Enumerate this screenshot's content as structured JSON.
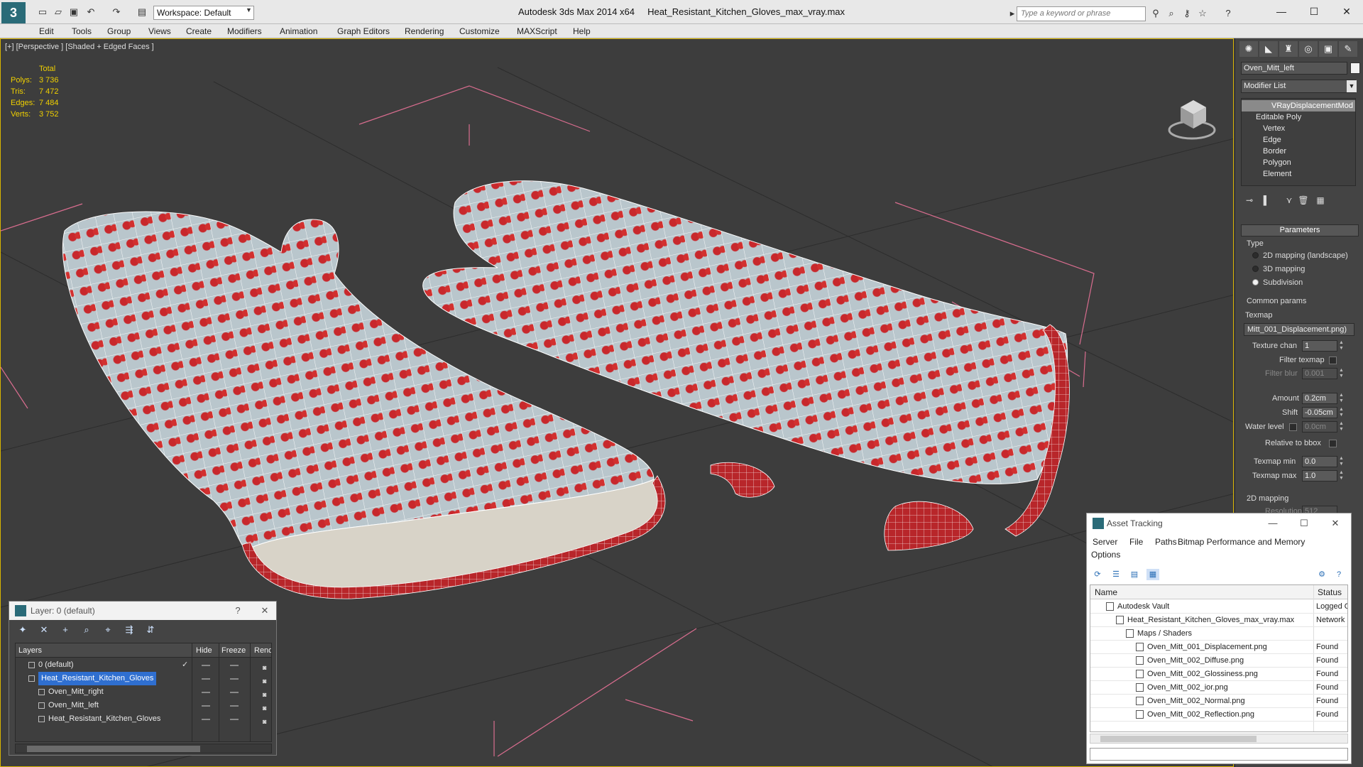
{
  "titlebar": {
    "app_title": "Autodesk 3ds Max  2014 x64",
    "file_name": "Heat_Resistant_Kitchen_Gloves_max_vray.max",
    "workspace": "Workspace: Default",
    "search_placeholder": "Type a keyword or phrase"
  },
  "menu": [
    "Edit",
    "Tools",
    "Group",
    "Views",
    "Create",
    "Modifiers",
    "Animation",
    "Graph Editors",
    "Rendering",
    "Customize",
    "MAXScript",
    "Help"
  ],
  "viewport": {
    "label": "[+] [Perspective ] [Shaded + Edged Faces ]",
    "stats": {
      "header": "Total",
      "rows": [
        {
          "k": "Polys:",
          "v": "3 736"
        },
        {
          "k": "Tris:",
          "v": "7 472"
        },
        {
          "k": "Edges:",
          "v": "7 484"
        },
        {
          "k": "Verts:",
          "v": "3 752"
        }
      ]
    }
  },
  "command_panel": {
    "object_name": "Oven_Mitt_left",
    "modifier_list": "Modifier List",
    "stack": [
      "VRayDisplacementMod",
      "Editable Poly",
      "Vertex",
      "Edge",
      "Border",
      "Polygon",
      "Element"
    ],
    "parameters": {
      "title": "Parameters",
      "type_label": "Type",
      "types": [
        "2D mapping (landscape)",
        "3D mapping",
        "Subdivision"
      ],
      "selected_type": "Subdivision",
      "common_label": "Common params",
      "texmap_label": "Texmap",
      "texmap_value": "Mitt_001_Displacement.png)",
      "texture_chan_label": "Texture chan",
      "texture_chan": "1",
      "filter_texmap_label": "Filter texmap",
      "filter_blur_label": "Filter blur",
      "filter_blur": "0.001",
      "amount_label": "Amount",
      "amount": "0.2cm",
      "shift_label": "Shift",
      "shift": "-0.05cm",
      "water_label": "Water level",
      "water": "0.0cm",
      "relative_label": "Relative to bbox",
      "texmap_min_label": "Texmap min",
      "texmap_min": "0.0",
      "texmap_max_label": "Texmap max",
      "texmap_max": "1.0",
      "mapping_2d_label": "2D mapping",
      "resolution_label": "Resolution",
      "resolution": "512"
    }
  },
  "asset_tracking": {
    "title": "Asset Tracking",
    "menu": [
      "Server",
      "File",
      "Paths",
      "Bitmap Performance and Memory",
      "Options"
    ],
    "columns": [
      "Name",
      "Status"
    ],
    "rows": [
      {
        "name": "Autodesk Vault",
        "status": "Logged O",
        "indent": 1
      },
      {
        "name": "Heat_Resistant_Kitchen_Gloves_max_vray.max",
        "status": "Network",
        "indent": 2
      },
      {
        "name": "Maps / Shaders",
        "status": "",
        "indent": 3
      },
      {
        "name": "Oven_Mitt_001_Displacement.png",
        "status": "Found",
        "indent": 4
      },
      {
        "name": "Oven_Mitt_002_Diffuse.png",
        "status": "Found",
        "indent": 4
      },
      {
        "name": "Oven_Mitt_002_Glossiness.png",
        "status": "Found",
        "indent": 4
      },
      {
        "name": "Oven_Mitt_002_ior.png",
        "status": "Found",
        "indent": 4
      },
      {
        "name": "Oven_Mitt_002_Normal.png",
        "status": "Found",
        "indent": 4
      },
      {
        "name": "Oven_Mitt_002_Reflection.png",
        "status": "Found",
        "indent": 4
      }
    ]
  },
  "layer_window": {
    "title": "Layer: 0 (default)",
    "columns": [
      "Layers",
      "Hide",
      "Freeze",
      "Rend"
    ],
    "rows": [
      {
        "name": "0 (default)",
        "indent": 1,
        "selected": false
      },
      {
        "name": "Heat_Resistant_Kitchen_Gloves",
        "indent": 1,
        "selected": true
      },
      {
        "name": "Oven_Mitt_right",
        "indent": 2,
        "selected": false
      },
      {
        "name": "Oven_Mitt_left",
        "indent": 2,
        "selected": false
      },
      {
        "name": "Heat_Resistant_Kitchen_Gloves",
        "indent": 2,
        "selected": false
      }
    ]
  },
  "colors": {
    "viewport_bg": "#3d3d3d",
    "stats_yellow": "#f0d000",
    "glove_fabric": "#b9c6cc",
    "glove_trim": "#b8262a",
    "cherry_red": "#c8282c",
    "selection_blue": "#2f6fd0"
  }
}
